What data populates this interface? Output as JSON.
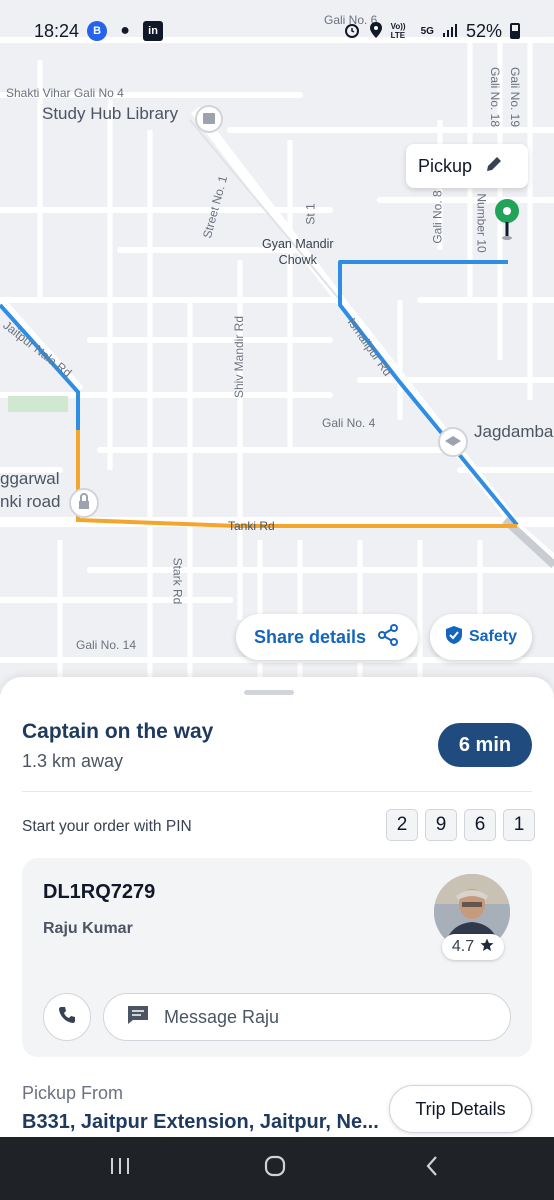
{
  "status_bar": {
    "time": "18:24",
    "left_icons": [
      "b-app-icon",
      "chat-bubble-icon",
      "linkedin-icon"
    ],
    "right_icons": [
      "alarm-icon",
      "location-icon",
      "volte-icon",
      "5g-icon",
      "signal-icon"
    ],
    "volte_text": "Vo)) LTE",
    "network_text": "5G",
    "battery": "52%"
  },
  "map": {
    "labels": {
      "gali6": "Gali No. 6",
      "shakti": "Shakti Vihar Gali No 4",
      "study": "Study Hub Library",
      "gali19": "Gali No. 19",
      "gali18": "Gali No. 18",
      "street1": "Street No. 1",
      "st1": "St 1",
      "gali8": "Gali No. 8",
      "number10": "Number 10",
      "gyan": "Gyan Mandir\nChowk",
      "jaitpur": "Jaitpur Nala Rd",
      "shiv": "Shiv Mandir Rd",
      "ismailpur": "Ismailpur Rd",
      "gali4": "Gali No. 4",
      "jagdamba": "Jagdamba",
      "aggarwal": "ggarwal\nnki road",
      "tanki": "Tanki Rd",
      "stark": "Stark Rd",
      "gali14": "Gali No. 14"
    },
    "route_colors": {
      "primary": "#2f8de4",
      "secondary": "#f3a52c"
    },
    "pickup_chip": {
      "label": "Pickup",
      "edit_icon": "pencil-icon"
    },
    "share_button": {
      "label": "Share details",
      "icon": "share-icon"
    },
    "safety_button": {
      "label": "Safety",
      "icon": "shield-icon"
    }
  },
  "sheet": {
    "title": "Captain on the way",
    "distance": "1.3 km away",
    "eta": "6 min",
    "pin_label": "Start your order with PIN",
    "pin": [
      "2",
      "9",
      "6",
      "1"
    ],
    "captain": {
      "plate": "DL1RQ7279",
      "name": "Raju Kumar",
      "rating": "4.7",
      "message_placeholder": "Message Raju"
    },
    "pickup_label": "Pickup From",
    "pickup_address": "B331, Jaitpur Extension, Jaitpur, Ne...",
    "trip_details": "Trip Details"
  },
  "colors": {
    "accent": "#1565c0",
    "title": "#1e3a5f",
    "eta_bg": "#1f4b7f",
    "pickup_pin": "#22a35a"
  }
}
